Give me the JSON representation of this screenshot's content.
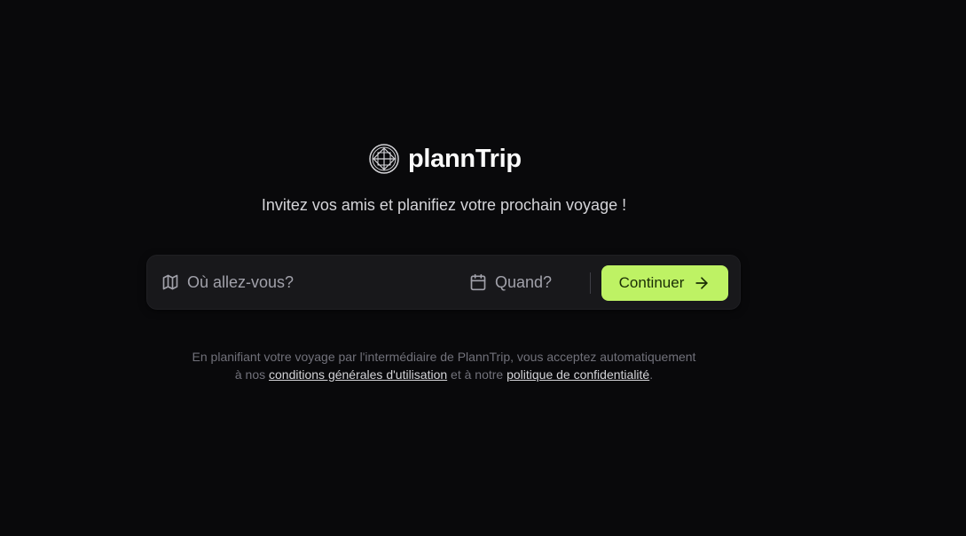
{
  "brand": {
    "name": "plannTrip",
    "logo_icon": "globe-icon"
  },
  "tagline": "Invitez vos amis et planifiez votre prochain voyage !",
  "search": {
    "destination_icon": "map-icon",
    "destination_placeholder": "Où allez-vous?",
    "destination_value": "",
    "date_icon": "calendar-icon",
    "date_placeholder": "Quand?",
    "date_value": "",
    "continue_label": "Continuer",
    "continue_icon": "arrow-right-icon"
  },
  "legal": {
    "line1": "En planifiant votre voyage par l'intermédiaire de PlannTrip, vous acceptez automatiquement",
    "prefix": "à nos ",
    "terms_link": "conditions générales d'utilisation",
    "middle": " et à notre ",
    "privacy_link": "politique de confidentialité",
    "suffix": "."
  },
  "colors": {
    "background": "#09090b",
    "accent": "#bef264",
    "surface": "#18181b"
  }
}
